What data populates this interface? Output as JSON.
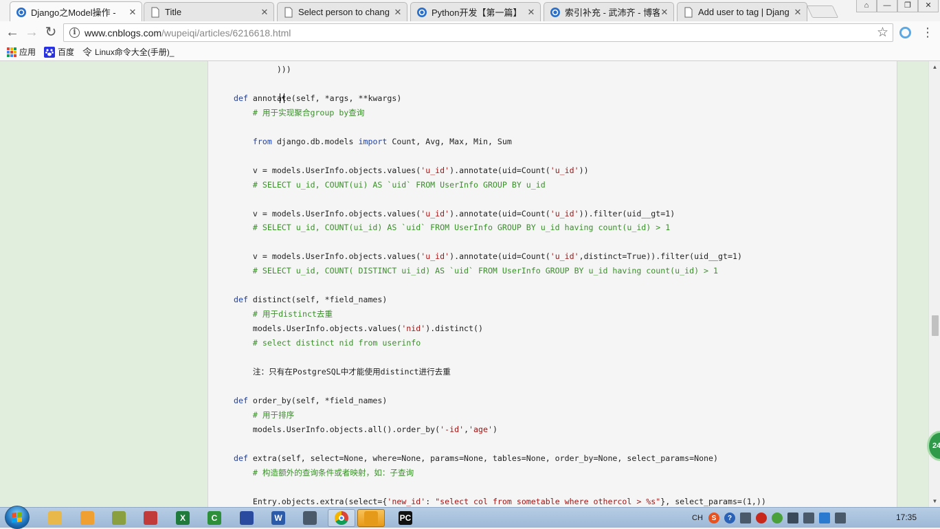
{
  "tabs": [
    {
      "title": "Django之Model操作 - ",
      "icon": "blog-logo-icon",
      "active": true
    },
    {
      "title": "Title",
      "icon": "page-icon",
      "active": false
    },
    {
      "title": "Select person to chang",
      "icon": "page-icon",
      "active": false
    },
    {
      "title": "Python开发【第一篇】",
      "icon": "blog-logo-icon",
      "active": false
    },
    {
      "title": "索引补充 - 武沛齐 - 博客",
      "icon": "blog-logo-icon",
      "active": false
    },
    {
      "title": "Add user to tag | Djang",
      "icon": "page-icon",
      "active": false
    }
  ],
  "toolbar": {
    "url_host": "www.cnblogs.com",
    "url_path": "/wupeiqi/articles/6216618.html"
  },
  "bookmarks": [
    {
      "label": "应用",
      "icon": "apps-grid-icon"
    },
    {
      "label": "百度",
      "icon": "baidu-paw-icon"
    },
    {
      "label": "Linux命令大全(手册)_",
      "icon": "linux-icon"
    }
  ],
  "code_lines": [
    [
      {
        "t": "         )))",
        "c": ""
      }
    ],
    [],
    [
      {
        "t": "def ",
        "c": "kw"
      },
      {
        "t": "annotate(self, *args, **kwargs)",
        "c": ""
      }
    ],
    [
      {
        "t": "    # 用于实现聚合group by查询",
        "c": "cm"
      }
    ],
    [],
    [
      {
        "t": "    ",
        "c": ""
      },
      {
        "t": "from ",
        "c": "kw"
      },
      {
        "t": "django.db.models ",
        "c": ""
      },
      {
        "t": "import ",
        "c": "kw"
      },
      {
        "t": "Count, Avg, Max, Min, Sum",
        "c": ""
      }
    ],
    [],
    [
      {
        "t": "    v = models.UserInfo.objects.values(",
        "c": ""
      },
      {
        "t": "'u_id'",
        "c": "str"
      },
      {
        "t": ").annotate(uid=Count(",
        "c": ""
      },
      {
        "t": "'u_id'",
        "c": "str"
      },
      {
        "t": "))",
        "c": ""
      }
    ],
    [
      {
        "t": "    # SELECT u_id, COUNT(ui) AS `uid` FROM UserInfo GROUP BY u_id",
        "c": "cm"
      }
    ],
    [],
    [
      {
        "t": "    v = models.UserInfo.objects.values(",
        "c": ""
      },
      {
        "t": "'u_id'",
        "c": "str"
      },
      {
        "t": ").annotate(uid=Count(",
        "c": ""
      },
      {
        "t": "'u_id'",
        "c": "str"
      },
      {
        "t": ")).filter(uid__gt=1)",
        "c": ""
      }
    ],
    [
      {
        "t": "    # SELECT u_id, COUNT(ui_id) AS `uid` FROM UserInfo GROUP BY u_id having count(u_id) > 1",
        "c": "cm"
      }
    ],
    [],
    [
      {
        "t": "    v = models.UserInfo.objects.values(",
        "c": ""
      },
      {
        "t": "'u_id'",
        "c": "str"
      },
      {
        "t": ").annotate(uid=Count(",
        "c": ""
      },
      {
        "t": "'u_id'",
        "c": "str"
      },
      {
        "t": ",distinct=True)).filter(uid__gt=1)",
        "c": ""
      }
    ],
    [
      {
        "t": "    # SELECT u_id, COUNT( DISTINCT ui_id) AS `uid` FROM UserInfo GROUP BY u_id having count(u_id) > 1",
        "c": "cm"
      }
    ],
    [],
    [
      {
        "t": "def ",
        "c": "kw"
      },
      {
        "t": "distinct(self, *field_names)",
        "c": ""
      }
    ],
    [
      {
        "t": "    # 用于distinct去重",
        "c": "cm"
      }
    ],
    [
      {
        "t": "    models.UserInfo.objects.values(",
        "c": ""
      },
      {
        "t": "'nid'",
        "c": "str"
      },
      {
        "t": ").distinct()",
        "c": ""
      }
    ],
    [
      {
        "t": "    # select distinct nid from userinfo",
        "c": "cm"
      }
    ],
    [],
    [
      {
        "t": "    注：只有在PostgreSQL中才能使用distinct进行去重",
        "c": ""
      }
    ],
    [],
    [
      {
        "t": "def ",
        "c": "kw"
      },
      {
        "t": "order_by(self, *field_names)",
        "c": ""
      }
    ],
    [
      {
        "t": "    # 用于排序",
        "c": "cm"
      }
    ],
    [
      {
        "t": "    models.UserInfo.objects.all().order_by(",
        "c": ""
      },
      {
        "t": "'-id'",
        "c": "str"
      },
      {
        "t": ",",
        "c": ""
      },
      {
        "t": "'age'",
        "c": "str"
      },
      {
        "t": ")",
        "c": ""
      }
    ],
    [],
    [
      {
        "t": "def ",
        "c": "kw"
      },
      {
        "t": "extra(self, select=None, where=None, params=None, tables=None, order_by=None, select_params=None)",
        "c": ""
      }
    ],
    [
      {
        "t": "    # 构造额外的查询条件或者映射，如：子查询",
        "c": "cm"
      }
    ],
    [],
    [
      {
        "t": "    Entry.objects.extra(select={",
        "c": ""
      },
      {
        "t": "'new_id'",
        "c": "str"
      },
      {
        "t": ": ",
        "c": ""
      },
      {
        "t": "\"select col from sometable where othercol > %s\"",
        "c": "str"
      },
      {
        "t": "}, select_params=(1,))",
        "c": ""
      }
    ]
  ],
  "side_badge": "24",
  "taskbar": {
    "items": [
      {
        "name": "explorer-icon",
        "label": "",
        "color": "#e8b84a"
      },
      {
        "name": "paint-icon",
        "label": "",
        "color": "#f0a030"
      },
      {
        "name": "notepad-icon",
        "label": "",
        "color": "#8aa040"
      },
      {
        "name": "tool-icon",
        "label": "",
        "color": "#c23b3b"
      },
      {
        "name": "excel-icon",
        "label": "X",
        "color": "#1f7a3b"
      },
      {
        "name": "c-app-icon",
        "label": "C",
        "color": "#2d8f3a"
      },
      {
        "name": "save-app-icon",
        "label": "",
        "color": "#2a4aa0"
      },
      {
        "name": "word-icon",
        "label": "W",
        "color": "#2b5aa8"
      },
      {
        "name": "network-tool-icon",
        "label": "",
        "color": "#4a5a6a"
      },
      {
        "name": "chrome-icon",
        "label": "",
        "color": "#dd4b39",
        "state": "active"
      },
      {
        "name": "audio-app-icon",
        "label": "",
        "color": "#e69a1a",
        "state": "highlighted"
      },
      {
        "name": "pycharm-icon",
        "label": "PC",
        "color": "#111111"
      }
    ],
    "tray": [
      {
        "name": "ime-indicator",
        "label": "CH"
      },
      {
        "name": "sogou-icon",
        "label": "S"
      },
      {
        "name": "help-icon",
        "label": "?"
      },
      {
        "name": "network-icon",
        "label": ""
      },
      {
        "name": "record-icon",
        "label": ""
      },
      {
        "name": "cross-icon",
        "label": ""
      },
      {
        "name": "monitor-icon",
        "label": ""
      },
      {
        "name": "display-icon",
        "label": ""
      },
      {
        "name": "input-method-icon",
        "label": ""
      },
      {
        "name": "volume-icon",
        "label": ""
      }
    ],
    "clock": "17:35"
  }
}
